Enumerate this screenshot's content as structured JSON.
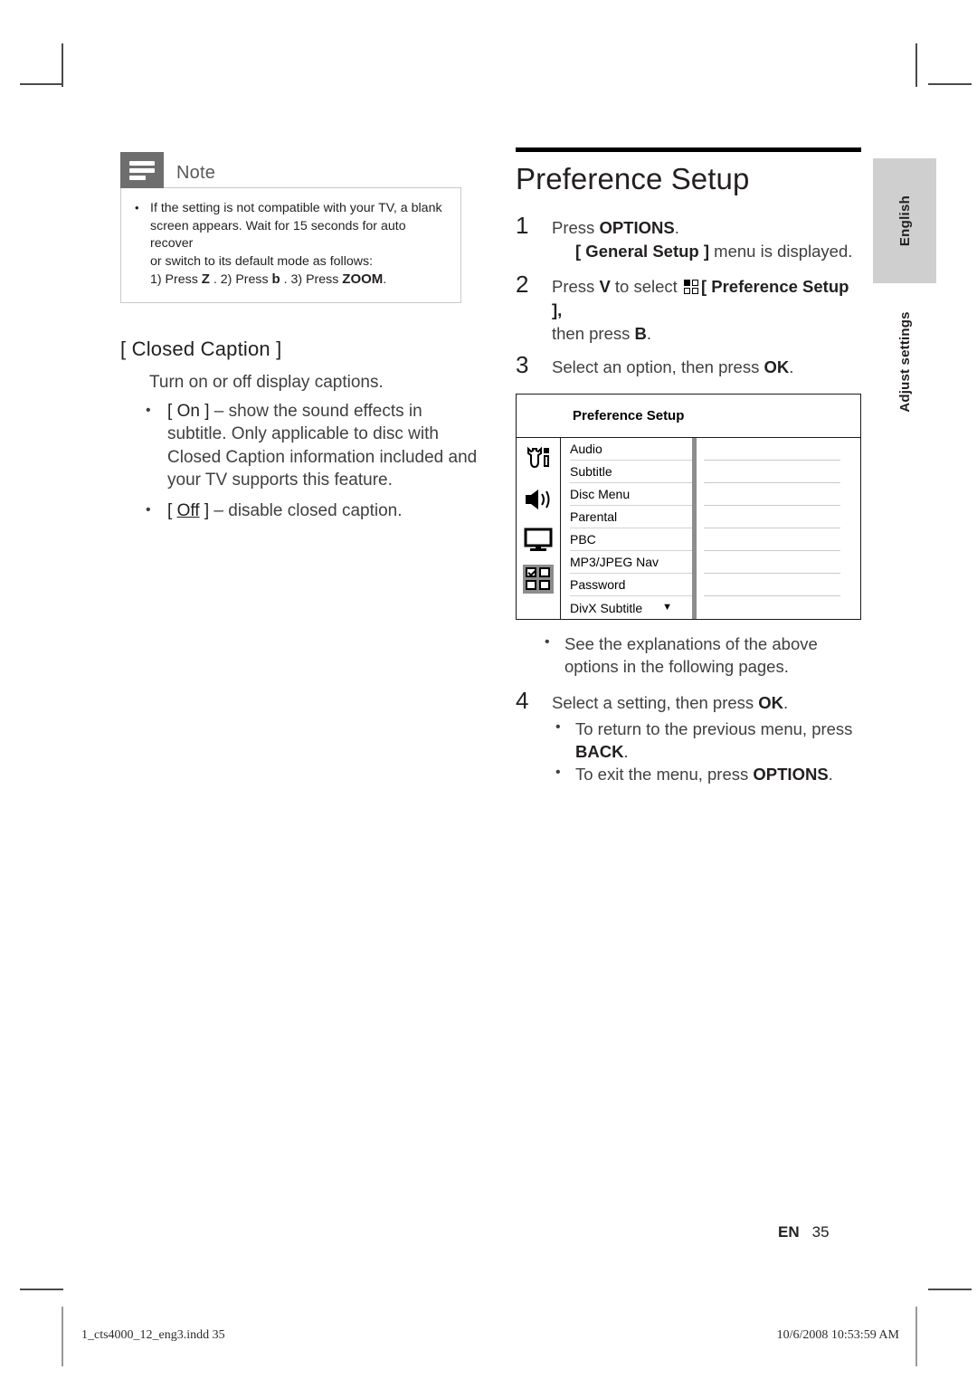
{
  "page": {
    "number_prefix": "EN",
    "number": "35",
    "footer_left": "1_cts4000_12_eng3.indd   35",
    "footer_right": "10/6/2008   10:53:59 AM"
  },
  "sidebar": {
    "language_tab": "English",
    "section_label": "Adjust settings"
  },
  "note": {
    "title": "Note",
    "icon": "note-lines-icon",
    "items": [
      "If the setting is not compatible with your TV, a blank screen appears. Wait for 15 seconds for auto recover or switch to its default mode as follows:",
      "1) Press Z . 2) Press b . 3) Press ZOOM."
    ],
    "keys": {
      "k1": "Z",
      "k2": "b",
      "k3": "ZOOM"
    },
    "line1": "If the setting is not compatible with your TV, a blank",
    "line2": "screen appears. Wait for 15 seconds for auto recover",
    "line3": "or switch to its default mode as follows:",
    "line4_a": "1) Press ",
    "line4_b": " . 2) Press ",
    "line4_c": " . 3) Press ",
    "line4_d": "."
  },
  "closed_caption": {
    "heading": "[ Closed Caption ]",
    "description": "Turn on or off display captions.",
    "options": [
      {
        "label": "On",
        "underlined": false,
        "text": " – show the sound effects in subtitle. Only applicable to disc with Closed Caption information included and your TV supports this feature."
      },
      {
        "label": "Off",
        "underlined": true,
        "text": " – disable closed caption."
      }
    ]
  },
  "main": {
    "title": "Preference Setup",
    "steps": [
      {
        "num": "1",
        "text_a": "Press ",
        "bold": "OPTIONS",
        "text_b": ".",
        "sub_a": "[ General Setup ]",
        "sub_b": " menu is displayed."
      },
      {
        "num": "2",
        "text_a": "Press ",
        "bold1": "V",
        "text_b": " to select ",
        "icon": "preference-grid-icon",
        "text_c": "[ Preference Setup ],",
        "text_d": "then press ",
        "bold2": "B",
        "text_e": "."
      },
      {
        "num": "3",
        "text_a": "Select an option, then press ",
        "bold": "OK",
        "text_b": "."
      },
      {
        "num": "4",
        "text_a": "Select a setting, then press ",
        "bold": "OK",
        "text_b": "."
      }
    ],
    "note_after_shot": "See the explanations of the above options in the following pages.",
    "step4_bullets": [
      {
        "text_a": "To return to the previous menu, press ",
        "bold": "BACK",
        "text_b": "."
      },
      {
        "text_a": "To exit the menu, press ",
        "bold": "OPTIONS",
        "text_b": "."
      }
    ]
  },
  "screenshot": {
    "title": "Preference Setup",
    "icons": [
      {
        "name": "tools-icon",
        "selected": false
      },
      {
        "name": "speaker-icon",
        "selected": false
      },
      {
        "name": "tv-icon",
        "selected": false
      },
      {
        "name": "grid-check-icon",
        "selected": true
      }
    ],
    "rows": [
      {
        "label": "Audio",
        "value": ""
      },
      {
        "label": "Subtitle",
        "value": ""
      },
      {
        "label": "Disc Menu",
        "value": ""
      },
      {
        "label": "Parental",
        "value": ""
      },
      {
        "label": "PBC",
        "value": ""
      },
      {
        "label": "MP3/JPEG Nav",
        "value": ""
      },
      {
        "label": "Password",
        "value": ""
      },
      {
        "label": "DivX Subtitle",
        "value": "",
        "caret": "▼"
      }
    ]
  },
  "colors": {
    "note_tab": "#6e6e6e",
    "sidebar_tab": "#cfcfcf",
    "rule": "#000000",
    "selected_icon_bg": "#8d8d8d"
  }
}
